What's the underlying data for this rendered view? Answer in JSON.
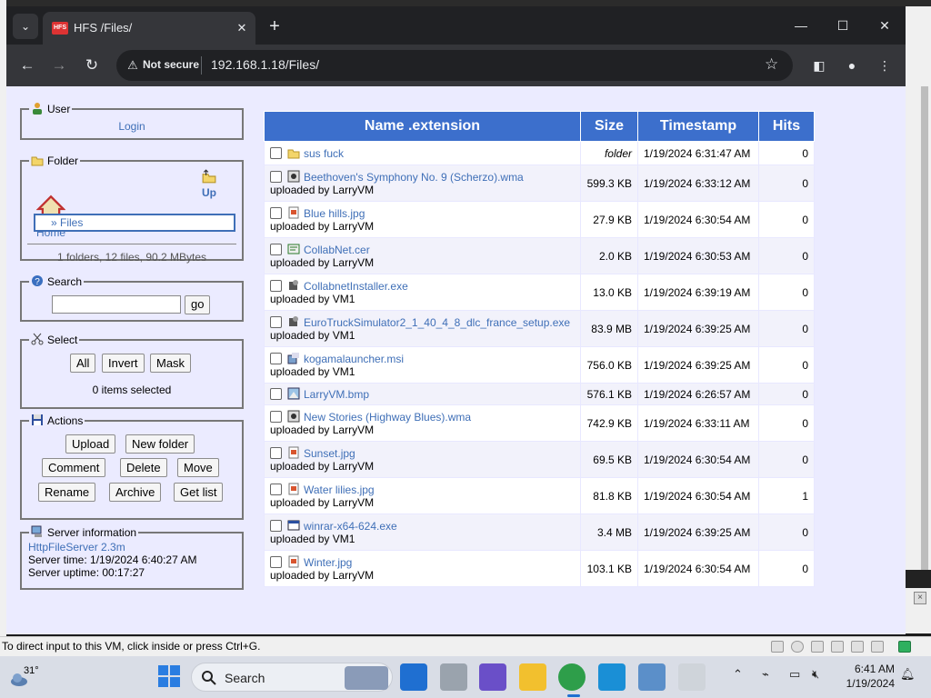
{
  "browser": {
    "tab_title": "HFS /Files/",
    "url": "192.168.1.18/Files/",
    "security_label": "Not secure"
  },
  "user_panel": {
    "legend": "User",
    "login": "Login"
  },
  "folder_panel": {
    "legend": "Folder",
    "up": "Up",
    "home": "Home",
    "current": "» Files",
    "summary": "1 folders, 12 files, 90.2 MBytes"
  },
  "search_panel": {
    "legend": "Search",
    "value": "",
    "go": "go"
  },
  "select_panel": {
    "legend": "Select",
    "all": "All",
    "invert": "Invert",
    "mask": "Mask",
    "status": "0 items selected"
  },
  "actions_panel": {
    "legend": "Actions",
    "upload": "Upload",
    "new_folder": "New folder",
    "comment": "Comment",
    "delete": "Delete",
    "move": "Move",
    "rename": "Rename",
    "archive": "Archive",
    "get_list": "Get list"
  },
  "server_panel": {
    "legend": "Server information",
    "version": "HttpFileServer 2.3m",
    "time": "Server time: 1/19/2024 6:40:27 AM",
    "uptime": "Server uptime: 00:17:27"
  },
  "table": {
    "headers": {
      "name": "Name .extension",
      "size": "Size",
      "timestamp": "Timestamp",
      "hits": "Hits"
    },
    "rows": [
      {
        "name": "sus fuck",
        "uploader": "",
        "size": "folder",
        "timestamp": "1/19/2024 6:31:47 AM",
        "hits": "0",
        "icon": "folder-icon"
      },
      {
        "name": "Beethoven's Symphony No. 9 (Scherzo).wma",
        "uploader": "uploaded by LarryVM",
        "size": "599.3 KB",
        "timestamp": "1/19/2024 6:33:12 AM",
        "hits": "0",
        "icon": "audio-file-icon"
      },
      {
        "name": "Blue hills.jpg",
        "uploader": "uploaded by LarryVM",
        "size": "27.9 KB",
        "timestamp": "1/19/2024 6:30:54 AM",
        "hits": "0",
        "icon": "image-file-icon"
      },
      {
        "name": "CollabNet.cer",
        "uploader": "uploaded by LarryVM",
        "size": "2.0 KB",
        "timestamp": "1/19/2024 6:30:53 AM",
        "hits": "0",
        "icon": "certificate-file-icon"
      },
      {
        "name": "CollabnetInstaller.exe",
        "uploader": "uploaded by VM1",
        "size": "13.0 KB",
        "timestamp": "1/19/2024 6:39:19 AM",
        "hits": "0",
        "icon": "installer-file-icon"
      },
      {
        "name": "EuroTruckSimulator2_1_40_4_8_dlc_france_setup.exe",
        "uploader": "uploaded by VM1",
        "size": "83.9 MB",
        "timestamp": "1/19/2024 6:39:25 AM",
        "hits": "0",
        "icon": "installer-file-icon"
      },
      {
        "name": "kogamalauncher.msi",
        "uploader": "uploaded by VM1",
        "size": "756.0 KB",
        "timestamp": "1/19/2024 6:39:25 AM",
        "hits": "0",
        "icon": "msi-file-icon"
      },
      {
        "name": "LarryVM.bmp",
        "uploader": "",
        "size": "576.1 KB",
        "timestamp": "1/19/2024 6:26:57 AM",
        "hits": "0",
        "icon": "bitmap-file-icon"
      },
      {
        "name": "New Stories (Highway Blues).wma",
        "uploader": "uploaded by LarryVM",
        "size": "742.9 KB",
        "timestamp": "1/19/2024 6:33:11 AM",
        "hits": "0",
        "icon": "audio-file-icon"
      },
      {
        "name": "Sunset.jpg",
        "uploader": "uploaded by LarryVM",
        "size": "69.5 KB",
        "timestamp": "1/19/2024 6:30:54 AM",
        "hits": "0",
        "icon": "image-file-icon"
      },
      {
        "name": "Water lilies.jpg",
        "uploader": "uploaded by LarryVM",
        "size": "81.8 KB",
        "timestamp": "1/19/2024 6:30:54 AM",
        "hits": "1",
        "icon": "image-file-icon"
      },
      {
        "name": "winrar-x64-624.exe",
        "uploader": "uploaded by VM1",
        "size": "3.4 MB",
        "timestamp": "1/19/2024 6:39:25 AM",
        "hits": "0",
        "icon": "window-exe-icon"
      },
      {
        "name": "Winter.jpg",
        "uploader": "uploaded by LarryVM",
        "size": "103.1 KB",
        "timestamp": "1/19/2024 6:30:54 AM",
        "hits": "0",
        "icon": "image-file-icon"
      }
    ]
  },
  "statusbar": {
    "message": "To direct input to this VM, click inside or press Ctrl+G."
  },
  "taskbar": {
    "weather_temp": "31°",
    "search_label": "Search",
    "time": "6:41 AM",
    "date": "1/19/2024"
  },
  "colors": {
    "header_blue": "#3c6fcc",
    "link_blue": "#3f6fb7",
    "page_bg": "#ebebff"
  }
}
